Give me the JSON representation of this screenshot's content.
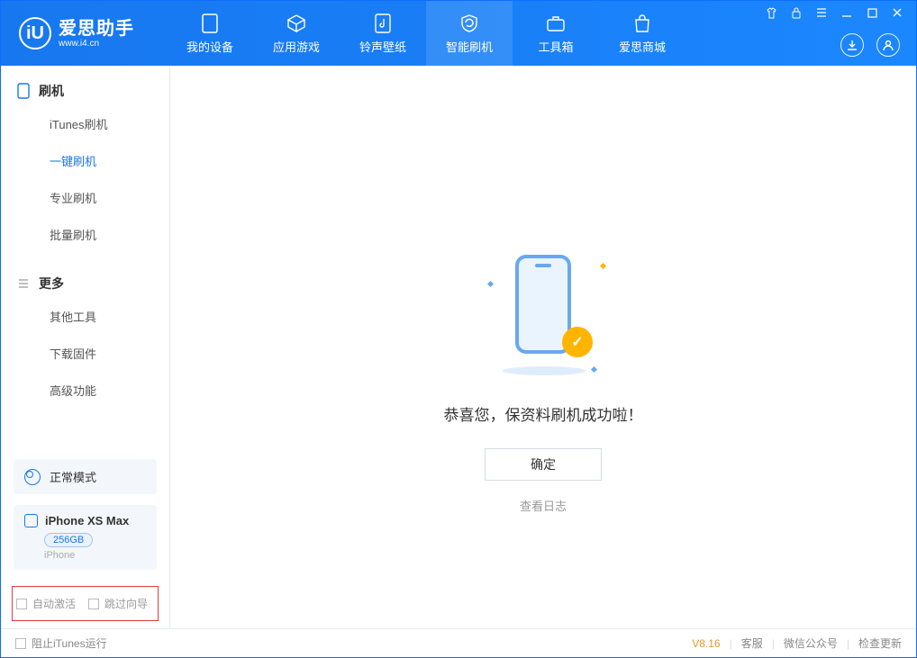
{
  "app": {
    "title": "爱思助手",
    "subtitle": "www.i4.cn"
  },
  "nav": {
    "items": [
      {
        "label": "我的设备"
      },
      {
        "label": "应用游戏"
      },
      {
        "label": "铃声壁纸"
      },
      {
        "label": "智能刷机"
      },
      {
        "label": "工具箱"
      },
      {
        "label": "爱思商城"
      }
    ]
  },
  "sidebar": {
    "group1_title": "刷机",
    "group1_items": [
      "iTunes刷机",
      "一键刷机",
      "专业刷机",
      "批量刷机"
    ],
    "group2_title": "更多",
    "group2_items": [
      "其他工具",
      "下载固件",
      "高级功能"
    ],
    "mode_label": "正常模式",
    "device": {
      "name": "iPhone XS Max",
      "capacity": "256GB",
      "type": "iPhone"
    },
    "options": {
      "auto_activate": "自动激活",
      "skip_guide": "跳过向导"
    }
  },
  "main": {
    "success_text": "恭喜您，保资料刷机成功啦！",
    "ok_button": "确定",
    "view_log": "查看日志"
  },
  "footer": {
    "block_itunes": "阻止iTunes运行",
    "version": "V8.16",
    "links": [
      "客服",
      "微信公众号",
      "检查更新"
    ]
  }
}
